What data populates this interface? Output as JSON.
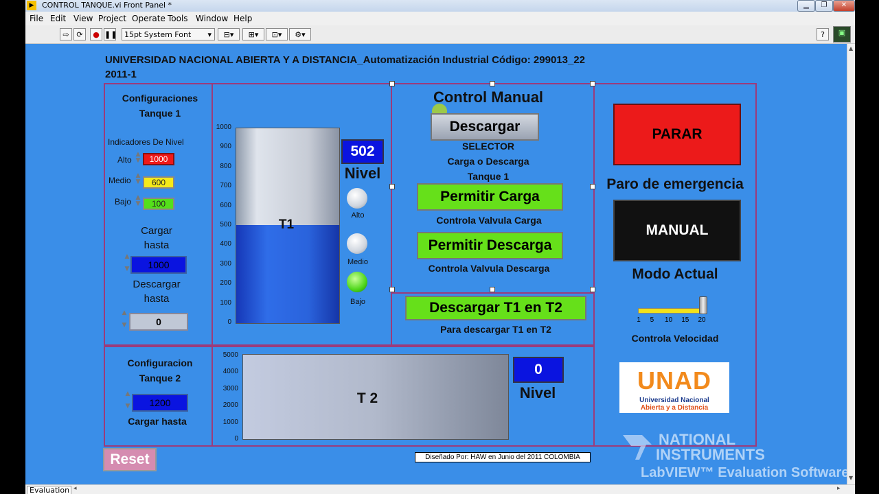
{
  "window": {
    "title": "CONTROL TANQUE.vi Front Panel *"
  },
  "menu": [
    "File",
    "Edit",
    "View",
    "Project",
    "Operate",
    "Tools",
    "Window",
    "Help"
  ],
  "toolbar": {
    "font": "15pt System Font",
    "help": "?"
  },
  "header": {
    "line1": "UNIVERSIDAD NACIONAL ABIERTA Y A DISTANCIA_Automatización Industrial Código: 299013_22",
    "line2": "2011-1"
  },
  "tank1_config": {
    "title1": "Configuraciones",
    "title2": "Tanque 1",
    "indicators_label": "Indicadores De Nivel",
    "alto_label": "Alto",
    "alto_value": "1000",
    "medio_label": "Medio",
    "medio_value": "600",
    "bajo_label": "Bajo",
    "bajo_value": "100",
    "cargar_label1": "Cargar",
    "cargar_label2": "hasta",
    "cargar_value": "1000",
    "descargar_label1": "Descargar",
    "descargar_label2": "hasta",
    "descargar_value": "0"
  },
  "tank1": {
    "name": "T1",
    "ticks": [
      "1000",
      "900",
      "800",
      "700",
      "600",
      "500",
      "400",
      "300",
      "200",
      "100",
      "0"
    ],
    "level": 502,
    "max": 1000,
    "level_display": "502",
    "level_label": "Nivel",
    "led_alto": "Alto",
    "led_medio": "Medio",
    "led_bajo": "Bajo"
  },
  "manual_control": {
    "title": "Control  Manual",
    "descargar_button": "Descargar",
    "selector1": "SELECTOR",
    "selector2": "Carga o Descarga",
    "selector3": "Tanque 1",
    "permitir_carga": "Permitir Carga",
    "permitir_carga_caption": "Controla Valvula Carga",
    "permitir_descarga": "Permitir Descarga",
    "permitir_descarga_caption": "Controla Valvula Descarga",
    "transfer_button": "Descargar T1 en T2",
    "transfer_caption": "Para descargar T1 en T2"
  },
  "right_panel": {
    "parar": "PARAR",
    "paro_caption": "Paro de emergencia",
    "manual": "MANUAL",
    "modo_caption": "Modo Actual",
    "slider_ticks": [
      "1",
      "5",
      "10",
      "15",
      "20"
    ],
    "slider_value": 20,
    "slider_caption": "Controla Velocidad"
  },
  "tank2_config": {
    "title1": "Configuracion",
    "title2": "Tanque 2",
    "cargar_value": "1200",
    "cargar_label": "Cargar hasta"
  },
  "tank2": {
    "name": "T 2",
    "ticks": [
      "5000",
      "4000",
      "3000",
      "2000",
      "1000",
      "0"
    ],
    "level_display": "0",
    "level_label": "Nivel"
  },
  "reset_button": "Reset",
  "credits": "Diseñado Por: HAW en Junio del  2011  COLOMBIA",
  "logo": {
    "unad": "UNAD",
    "line1": "Universidad Nacional",
    "line2": "Abierta y a Distancia"
  },
  "watermark": {
    "ni1": "NATIONAL",
    "ni2": "INSTRUMENTS",
    "lv": "LabVIEW™ Evaluation Software"
  },
  "statusbar": {
    "tab": "Evaluation"
  },
  "colors": {
    "panel": "#3a8ee8",
    "border": "#9b3b7b",
    "green_button": "#66e01a",
    "red_button": "#ec1a1a",
    "black_button": "#111111",
    "numeric_blue": "#0a14e0"
  }
}
